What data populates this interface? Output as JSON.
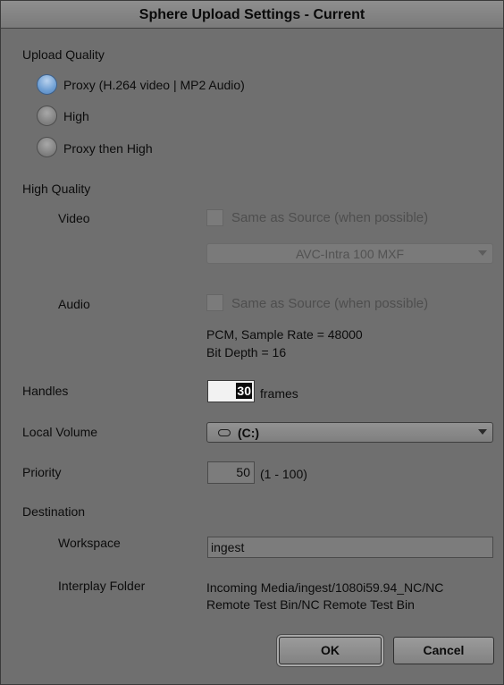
{
  "window": {
    "title": "Sphere Upload Settings - Current"
  },
  "upload_quality": {
    "label": "Upload Quality",
    "options": [
      {
        "label": "Proxy (H.264 video | MP2 Audio)",
        "selected": true
      },
      {
        "label": "High",
        "selected": false
      },
      {
        "label": "Proxy then High",
        "selected": false
      }
    ]
  },
  "high_quality": {
    "label": "High Quality",
    "video": {
      "label": "Video",
      "same_as_source_label": "Same as Source (when possible)",
      "same_as_source_checked": false,
      "format_value": "AVC-Intra 100  MXF"
    },
    "audio": {
      "label": "Audio",
      "same_as_source_label": "Same as Source (when possible)",
      "same_as_source_checked": false,
      "info_line1": "PCM, Sample Rate = 48000",
      "info_line2": "Bit Depth = 16"
    }
  },
  "handles": {
    "label": "Handles",
    "value": "30",
    "unit": "frames"
  },
  "local_volume": {
    "label": "Local Volume",
    "value": "(C:)",
    "icon": "drive-icon"
  },
  "priority": {
    "label": "Priority",
    "value": "50",
    "range": "(1 - 100)"
  },
  "destination": {
    "label": "Destination",
    "workspace_label": "Workspace",
    "workspace_value": "ingest",
    "interplay_folder_label": "Interplay Folder",
    "interplay_folder_line1": "Incoming Media/ingest/1080i59.94_NC/NC",
    "interplay_folder_line2": "Remote Test Bin/NC Remote Test Bin"
  },
  "buttons": {
    "ok": "OK",
    "cancel": "Cancel"
  },
  "colors": {
    "selected_radio": "#6f9fd3",
    "background": "#6f6f6f"
  }
}
